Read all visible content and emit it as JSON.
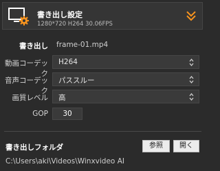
{
  "header": {
    "title": "書き出し設定",
    "spec": "1280*720  H264  30.06FPS",
    "icon": "monitor-gear-icon",
    "expand_icon": "double-chevron-down-icon",
    "accent_color": "#f7931e"
  },
  "export": {
    "label": "書き出し",
    "filename": "frame-01.mp4"
  },
  "video_codec": {
    "label": "動画コーデック",
    "value": "H264"
  },
  "audio_codec": {
    "label": "音声コーデック",
    "value": "パススルー"
  },
  "quality": {
    "label": "画質レベル",
    "value": "高"
  },
  "gop": {
    "label": "GOP",
    "value": "30"
  },
  "folder": {
    "label": "書き出しフォルダ",
    "browse_label": "参照",
    "open_label": "開く",
    "path": "C:\\Users\\aki\\Videos\\Winxvideo AI"
  }
}
